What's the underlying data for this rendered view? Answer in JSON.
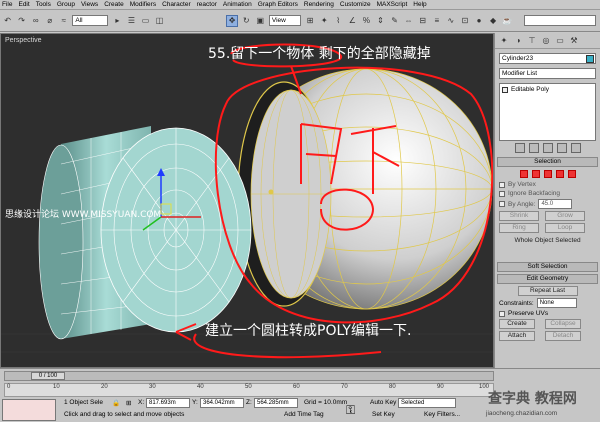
{
  "menu": [
    "File",
    "Edit",
    "Tools",
    "Group",
    "Views",
    "Create",
    "Modifiers",
    "Character",
    "reactor",
    "Animation",
    "Graph Editors",
    "Rendering",
    "Customize",
    "MAXScript",
    "Help"
  ],
  "toolbar": {
    "filter_value": "All",
    "view_value": "View"
  },
  "viewport": {
    "label": "Perspective",
    "caption_top": "55.留下一个物体 剩下的全部隐藏掉",
    "caption_bottom": "建立一个圆柱转成POLY编辑一下.",
    "caption_side": "思缘设计论坛 WWW.MISSYUAN.COM",
    "annotation_text": "留下"
  },
  "command_panel": {
    "object_name": "Cylinder23",
    "modifier_list": "Modifier List",
    "stack_item": "Editable Poly",
    "selection_rollout": "Selection",
    "by_vertex": "By Vertex",
    "ignore_backfacing": "Ignore Backfacing",
    "by_angle": "By Angle:",
    "angle_value": "45.0",
    "shrink": "Shrink",
    "grow": "Grow",
    "ring": "Ring",
    "loop": "Loop",
    "selection_status": "Whole Object Selected",
    "soft_selection": "Soft Selection",
    "edit_geometry": "Edit Geometry",
    "repeat_last": "Repeat Last",
    "constraints_label": "Constraints:",
    "constraints_value": "None",
    "preserve_uvs": "Preserve UVs",
    "create": "Create",
    "collapse": "Collapse",
    "attach": "Attach",
    "detach": "Detach"
  },
  "timeline": {
    "frame_display": "0 / 100",
    "ticks": [
      "0",
      "10",
      "20",
      "30",
      "40",
      "50",
      "60",
      "70",
      "80",
      "90",
      "100"
    ]
  },
  "status": {
    "selected_count": "1 Object Sele",
    "prompt": "Click and drag to select and move objects",
    "x_label": "X:",
    "x_value": "817.693m",
    "y_label": "Y:",
    "y_value": "364.042mm",
    "z_label": "Z:",
    "z_value": "564.285mm",
    "grid": "Grid = 10.0mm",
    "add_time_tag": "Add Time Tag",
    "auto_key": "Auto Key",
    "auto_key_value": "Selected",
    "set_key": "Set Key",
    "key_filters": "Key Filters..."
  },
  "watermark": {
    "line1": "查字典 教程网",
    "line2": "jiaocheng.chazidian.com"
  }
}
